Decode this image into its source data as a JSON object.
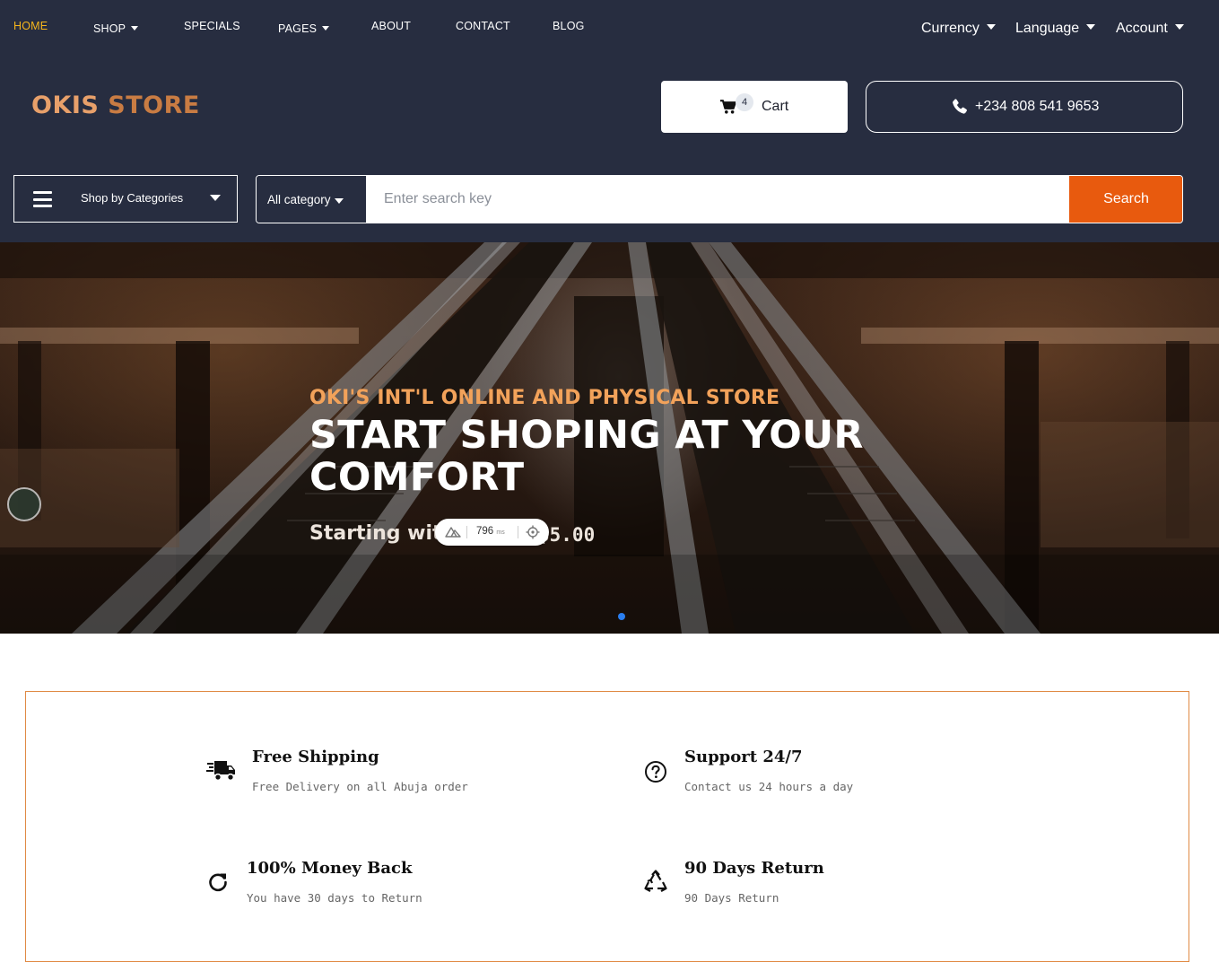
{
  "nav": {
    "items": [
      {
        "label": "HOME",
        "active": true,
        "dropdown": false
      },
      {
        "label": "SHOP",
        "active": false,
        "dropdown": true
      },
      {
        "label": "SPECIALS",
        "active": false,
        "dropdown": false
      },
      {
        "label": "PAGES",
        "active": false,
        "dropdown": true
      },
      {
        "label": "ABOUT",
        "active": false,
        "dropdown": false
      },
      {
        "label": "CONTACT",
        "active": false,
        "dropdown": false
      },
      {
        "label": "BLOG",
        "active": false,
        "dropdown": false
      }
    ],
    "utility": {
      "currency": "Currency",
      "language": "Language",
      "account": "Account"
    }
  },
  "brand": {
    "word1": "OKIS",
    "word2": "STORE"
  },
  "cart": {
    "label": "Cart",
    "count": "4"
  },
  "phone": {
    "number": "+234 808 541 9653"
  },
  "categories": {
    "label": "Shop by Categories"
  },
  "search": {
    "category": "All category",
    "placeholder": "Enter search key",
    "button": "Search"
  },
  "hero": {
    "kicker": "OKI'S INT'L ONLINE AND PHYSICAL STORE",
    "title": "START SHOPING AT YOUR COMFORT",
    "subtitle": "Starting with",
    "price": "$5.00",
    "perf_ms": "796",
    "perf_unit": "ms"
  },
  "features": [
    {
      "icon": "shipping-truck-icon",
      "title": "Free Shipping",
      "desc": "Free Delivery on all Abuja order"
    },
    {
      "icon": "question-circle-icon",
      "title": "Support 24/7",
      "desc": "Contact us 24 hours a day"
    },
    {
      "icon": "refresh-arrow-icon",
      "title": "100% Money Back",
      "desc": "You have 30 days to Return"
    },
    {
      "icon": "recycle-icon",
      "title": "90 Days Return",
      "desc": "90 Days Return"
    }
  ],
  "colors": {
    "header_bg": "#272d40",
    "active_nav": "#f5b51c",
    "search_button": "#e85a0e",
    "brand_orange": "#e8a06a",
    "feature_border": "#e08a44",
    "slider_dot": "#2a7ef0"
  }
}
